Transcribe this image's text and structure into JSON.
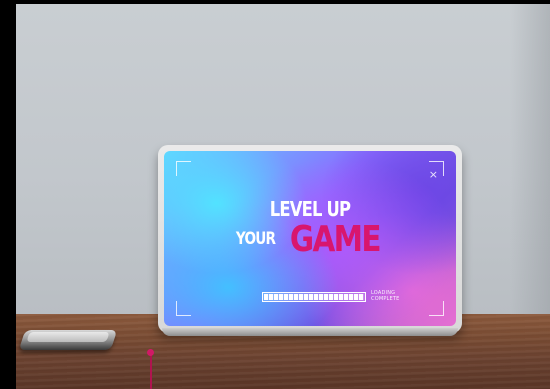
{
  "skin": {
    "headline_line1": "LEVEL UP",
    "headline_your": "YOUR",
    "headline_game": "GAME",
    "close_symbol": "×",
    "loading_status_line1": "LOADING",
    "loading_status_line2": "COMPLETE",
    "progress_fraction": 1.0
  },
  "colors": {
    "accent_pink": "#d8166e",
    "cable": "#b0144f"
  }
}
